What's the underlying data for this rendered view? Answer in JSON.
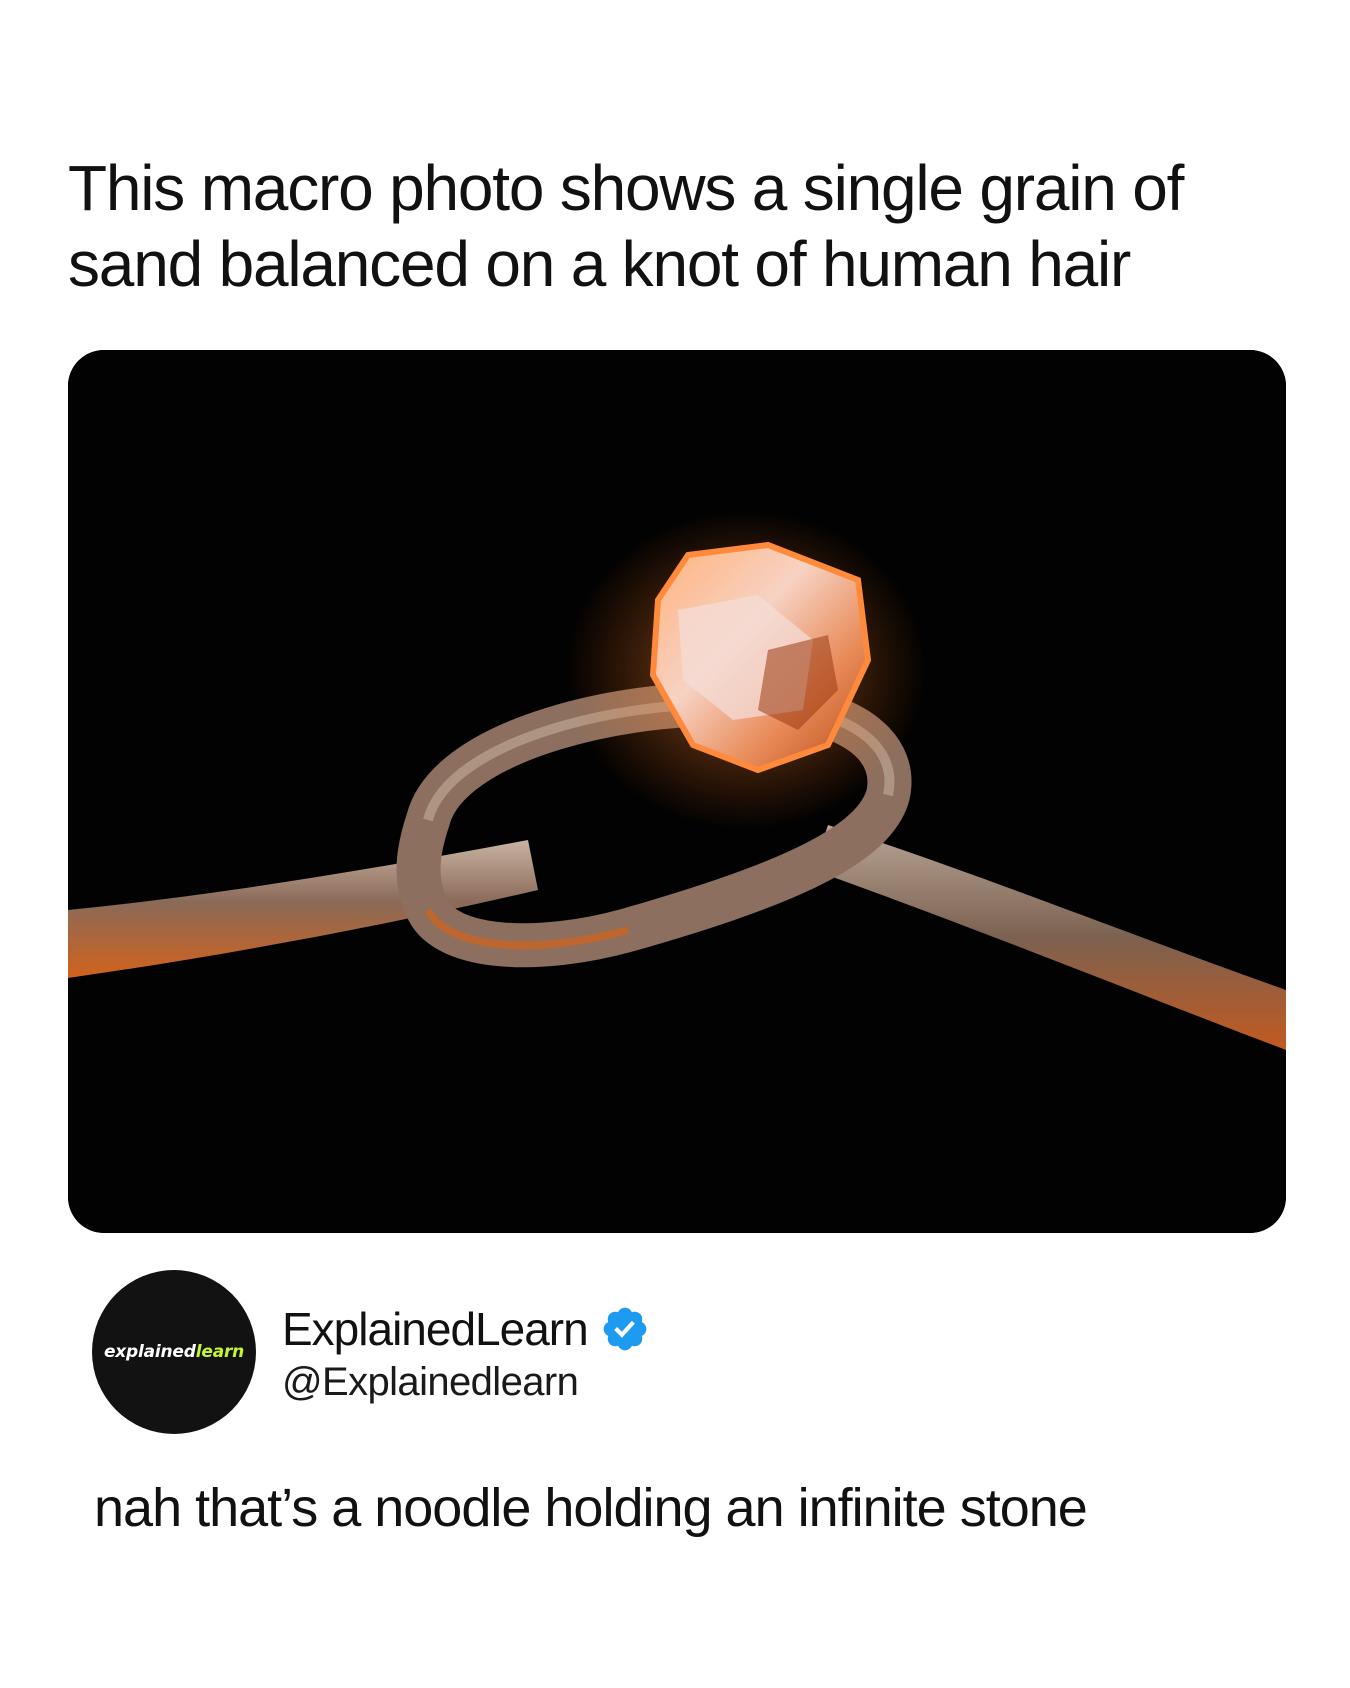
{
  "post": {
    "headline": "This macro photo shows a single grain of sand balanced on a knot of human hair",
    "reply_text": "nah that’s a noodle holding an infinite stone"
  },
  "author": {
    "display_name": "ExplainedLearn",
    "handle": "@Explainedlearn",
    "avatar_logo_part1": "explained",
    "avatar_logo_part2": "learn",
    "verified_icon": "verified-badge-icon",
    "verified_color": "#1d9bf0"
  },
  "colors": {
    "photo_background": "#020202",
    "logo_accent": "#c6f432",
    "crystal_glow": "#ff8a3c"
  }
}
